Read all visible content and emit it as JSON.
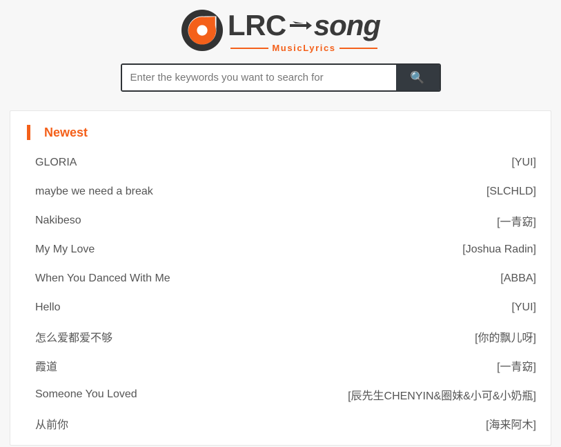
{
  "header": {
    "logo": {
      "mark_icon": "vinyl-record-droplet-icon",
      "word_primary": "LRC",
      "arrow_icon": "arrow-right-icon",
      "word_secondary": "song",
      "subtitle": "MusicLyrics",
      "brand_color": "#f4601a",
      "text_color": "#3a3a3a"
    }
  },
  "search": {
    "placeholder": "Enter the keywords you want to search for",
    "value": "",
    "button_icon": "search-icon",
    "button_glyph": "🔍",
    "button_color": "#343a40"
  },
  "main": {
    "section_title": "Newest",
    "accent_color": "#f4601a",
    "items": [
      {
        "title": "GLORIA",
        "artist": "[YUI]"
      },
      {
        "title": "maybe we need a break",
        "artist": "[SLCHLD]"
      },
      {
        "title": "Nakibeso",
        "artist": "[一青窈]"
      },
      {
        "title": "My My Love",
        "artist": "[Joshua Radin]"
      },
      {
        "title": "When You Danced With Me",
        "artist": "[ABBA]"
      },
      {
        "title": "Hello",
        "artist": "[YUI]"
      },
      {
        "title": "怎么爱都爱不够",
        "artist": "[你的飘儿呀]"
      },
      {
        "title": "霞道",
        "artist": "[一青窈]"
      },
      {
        "title": "Someone You Loved",
        "artist": "[辰先生CHENYIN&圈妹&小可&小奶瓶]"
      },
      {
        "title": "从前你",
        "artist": "[海来阿木]"
      }
    ]
  }
}
